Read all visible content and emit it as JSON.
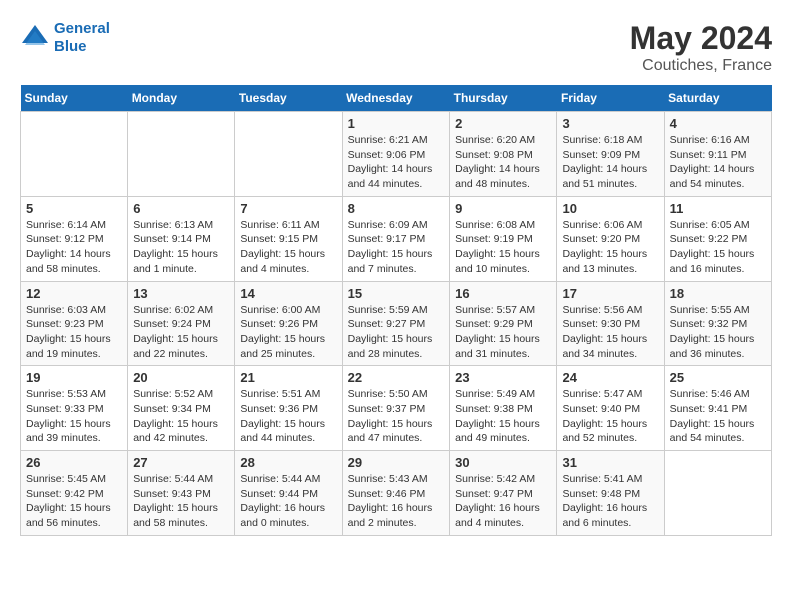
{
  "header": {
    "logo_line1": "General",
    "logo_line2": "Blue",
    "month_year": "May 2024",
    "location": "Coutiches, France"
  },
  "days_of_week": [
    "Sunday",
    "Monday",
    "Tuesday",
    "Wednesday",
    "Thursday",
    "Friday",
    "Saturday"
  ],
  "weeks": [
    [
      {
        "day": "",
        "detail": ""
      },
      {
        "day": "",
        "detail": ""
      },
      {
        "day": "",
        "detail": ""
      },
      {
        "day": "1",
        "detail": "Sunrise: 6:21 AM\nSunset: 9:06 PM\nDaylight: 14 hours\nand 44 minutes."
      },
      {
        "day": "2",
        "detail": "Sunrise: 6:20 AM\nSunset: 9:08 PM\nDaylight: 14 hours\nand 48 minutes."
      },
      {
        "day": "3",
        "detail": "Sunrise: 6:18 AM\nSunset: 9:09 PM\nDaylight: 14 hours\nand 51 minutes."
      },
      {
        "day": "4",
        "detail": "Sunrise: 6:16 AM\nSunset: 9:11 PM\nDaylight: 14 hours\nand 54 minutes."
      }
    ],
    [
      {
        "day": "5",
        "detail": "Sunrise: 6:14 AM\nSunset: 9:12 PM\nDaylight: 14 hours\nand 58 minutes."
      },
      {
        "day": "6",
        "detail": "Sunrise: 6:13 AM\nSunset: 9:14 PM\nDaylight: 15 hours\nand 1 minute."
      },
      {
        "day": "7",
        "detail": "Sunrise: 6:11 AM\nSunset: 9:15 PM\nDaylight: 15 hours\nand 4 minutes."
      },
      {
        "day": "8",
        "detail": "Sunrise: 6:09 AM\nSunset: 9:17 PM\nDaylight: 15 hours\nand 7 minutes."
      },
      {
        "day": "9",
        "detail": "Sunrise: 6:08 AM\nSunset: 9:19 PM\nDaylight: 15 hours\nand 10 minutes."
      },
      {
        "day": "10",
        "detail": "Sunrise: 6:06 AM\nSunset: 9:20 PM\nDaylight: 15 hours\nand 13 minutes."
      },
      {
        "day": "11",
        "detail": "Sunrise: 6:05 AM\nSunset: 9:22 PM\nDaylight: 15 hours\nand 16 minutes."
      }
    ],
    [
      {
        "day": "12",
        "detail": "Sunrise: 6:03 AM\nSunset: 9:23 PM\nDaylight: 15 hours\nand 19 minutes."
      },
      {
        "day": "13",
        "detail": "Sunrise: 6:02 AM\nSunset: 9:24 PM\nDaylight: 15 hours\nand 22 minutes."
      },
      {
        "day": "14",
        "detail": "Sunrise: 6:00 AM\nSunset: 9:26 PM\nDaylight: 15 hours\nand 25 minutes."
      },
      {
        "day": "15",
        "detail": "Sunrise: 5:59 AM\nSunset: 9:27 PM\nDaylight: 15 hours\nand 28 minutes."
      },
      {
        "day": "16",
        "detail": "Sunrise: 5:57 AM\nSunset: 9:29 PM\nDaylight: 15 hours\nand 31 minutes."
      },
      {
        "day": "17",
        "detail": "Sunrise: 5:56 AM\nSunset: 9:30 PM\nDaylight: 15 hours\nand 34 minutes."
      },
      {
        "day": "18",
        "detail": "Sunrise: 5:55 AM\nSunset: 9:32 PM\nDaylight: 15 hours\nand 36 minutes."
      }
    ],
    [
      {
        "day": "19",
        "detail": "Sunrise: 5:53 AM\nSunset: 9:33 PM\nDaylight: 15 hours\nand 39 minutes."
      },
      {
        "day": "20",
        "detail": "Sunrise: 5:52 AM\nSunset: 9:34 PM\nDaylight: 15 hours\nand 42 minutes."
      },
      {
        "day": "21",
        "detail": "Sunrise: 5:51 AM\nSunset: 9:36 PM\nDaylight: 15 hours\nand 44 minutes."
      },
      {
        "day": "22",
        "detail": "Sunrise: 5:50 AM\nSunset: 9:37 PM\nDaylight: 15 hours\nand 47 minutes."
      },
      {
        "day": "23",
        "detail": "Sunrise: 5:49 AM\nSunset: 9:38 PM\nDaylight: 15 hours\nand 49 minutes."
      },
      {
        "day": "24",
        "detail": "Sunrise: 5:47 AM\nSunset: 9:40 PM\nDaylight: 15 hours\nand 52 minutes."
      },
      {
        "day": "25",
        "detail": "Sunrise: 5:46 AM\nSunset: 9:41 PM\nDaylight: 15 hours\nand 54 minutes."
      }
    ],
    [
      {
        "day": "26",
        "detail": "Sunrise: 5:45 AM\nSunset: 9:42 PM\nDaylight: 15 hours\nand 56 minutes."
      },
      {
        "day": "27",
        "detail": "Sunrise: 5:44 AM\nSunset: 9:43 PM\nDaylight: 15 hours\nand 58 minutes."
      },
      {
        "day": "28",
        "detail": "Sunrise: 5:44 AM\nSunset: 9:44 PM\nDaylight: 16 hours\nand 0 minutes."
      },
      {
        "day": "29",
        "detail": "Sunrise: 5:43 AM\nSunset: 9:46 PM\nDaylight: 16 hours\nand 2 minutes."
      },
      {
        "day": "30",
        "detail": "Sunrise: 5:42 AM\nSunset: 9:47 PM\nDaylight: 16 hours\nand 4 minutes."
      },
      {
        "day": "31",
        "detail": "Sunrise: 5:41 AM\nSunset: 9:48 PM\nDaylight: 16 hours\nand 6 minutes."
      },
      {
        "day": "",
        "detail": ""
      }
    ]
  ]
}
